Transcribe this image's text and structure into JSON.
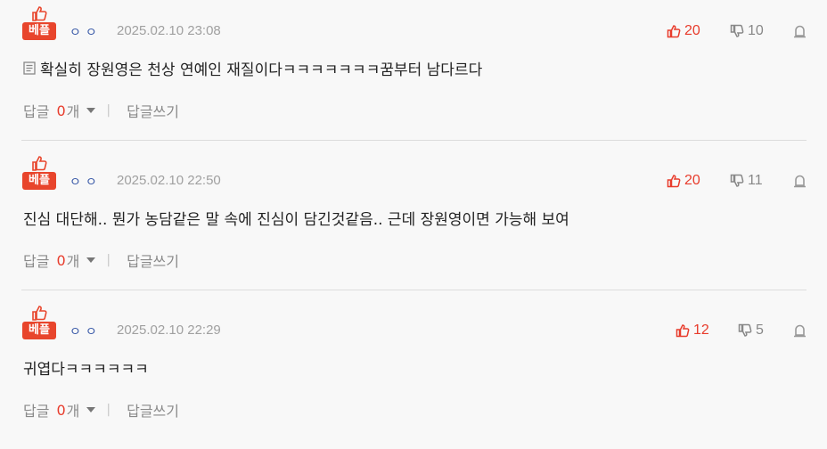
{
  "colors": {
    "accent": "#e83c2c",
    "badge": "#e8452c",
    "nick": "#3a5aa8",
    "muted": "#a0a0a0"
  },
  "comments": [
    {
      "badge": "베플",
      "nick": "ㅇㅇ",
      "date": "2025.02.10 23:08",
      "up": "20",
      "down": "10",
      "has_memo_icon": true,
      "text": "확실히 장원영은 천상 연예인 재질이다ㅋㅋㅋㅋㅋㅋㅋ꿈부터 남다르다",
      "reply_label": "답글",
      "reply_count": "0",
      "reply_unit": "개",
      "reply_write": "답글쓰기"
    },
    {
      "badge": "베플",
      "nick": "ㅇㅇ",
      "date": "2025.02.10 22:50",
      "up": "20",
      "down": "11",
      "has_memo_icon": false,
      "text": "진심 대단해.. 뭔가 농담같은 말 속에 진심이 담긴것같음.. 근데 장원영이면 가능해 보여",
      "reply_label": "답글",
      "reply_count": "0",
      "reply_unit": "개",
      "reply_write": "답글쓰기"
    },
    {
      "badge": "베플",
      "nick": "ㅇㅇ",
      "date": "2025.02.10 22:29",
      "up": "12",
      "down": "5",
      "has_memo_icon": false,
      "text": "귀엽다ㅋㅋㅋㅋㅋㅋ",
      "reply_label": "답글",
      "reply_count": "0",
      "reply_unit": "개",
      "reply_write": "답글쓰기"
    }
  ]
}
